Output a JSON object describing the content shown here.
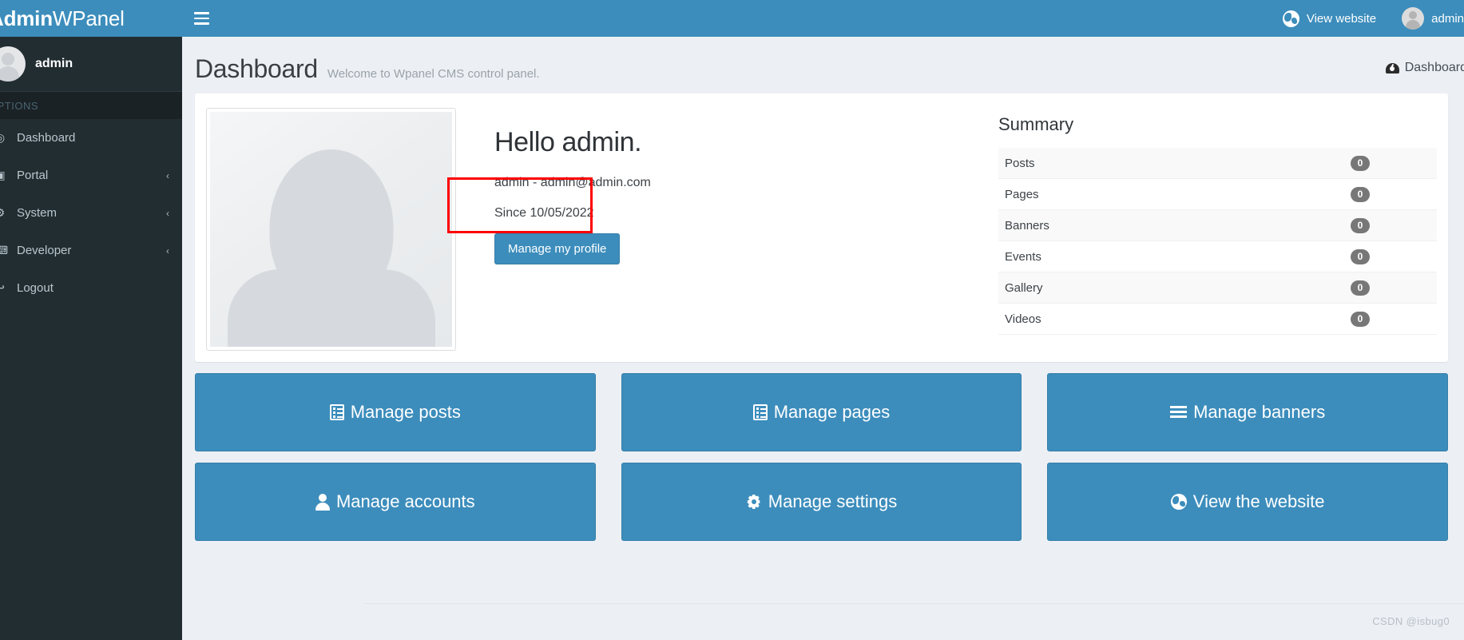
{
  "brand": {
    "bold": "Admin",
    "light": "WPanel"
  },
  "sidebar": {
    "user": "admin",
    "section_label": "OPTIONS",
    "items": [
      {
        "label": "Dashboard",
        "icon": "dashboard-icon",
        "arrow": ""
      },
      {
        "label": "Portal",
        "icon": "portal-icon",
        "arrow": "‹"
      },
      {
        "label": "System",
        "icon": "system-icon",
        "arrow": "‹"
      },
      {
        "label": "Developer",
        "icon": "developer-icon",
        "arrow": "‹"
      },
      {
        "label": "Logout",
        "icon": "logout-icon",
        "arrow": ""
      }
    ]
  },
  "navbar": {
    "view_website": "View website",
    "user": "admin"
  },
  "header": {
    "title": "Dashboard",
    "subtitle": "Welcome to Wpanel CMS control panel.",
    "breadcrumb": "Dashboard"
  },
  "profile": {
    "hello": "Hello admin.",
    "meta": "admin - admin@admin.com",
    "since": "Since 10/05/2022",
    "manage_button": "Manage my profile"
  },
  "summary": {
    "title": "Summary",
    "rows": [
      {
        "label": "Posts",
        "count": "0"
      },
      {
        "label": "Pages",
        "count": "0"
      },
      {
        "label": "Banners",
        "count": "0"
      },
      {
        "label": "Events",
        "count": "0"
      },
      {
        "label": "Gallery",
        "count": "0"
      },
      {
        "label": "Videos",
        "count": "0"
      }
    ]
  },
  "actions": [
    {
      "label": "Manage posts",
      "icon": "list-icon"
    },
    {
      "label": "Manage pages",
      "icon": "list-icon"
    },
    {
      "label": "Manage banners",
      "icon": "bars-icon"
    },
    {
      "label": "Manage accounts",
      "icon": "user-icon"
    },
    {
      "label": "Manage settings",
      "icon": "gear-icon"
    },
    {
      "label": "View the website",
      "icon": "globe-icon"
    }
  ],
  "watermark": "CSDN @isbug0",
  "colors": {
    "brand_blue": "#3c8dbc",
    "sidebar_dark": "#222d32",
    "content_bg": "#ecf0f5",
    "annotation_red": "#ff0000",
    "badge_gray": "#777777"
  }
}
